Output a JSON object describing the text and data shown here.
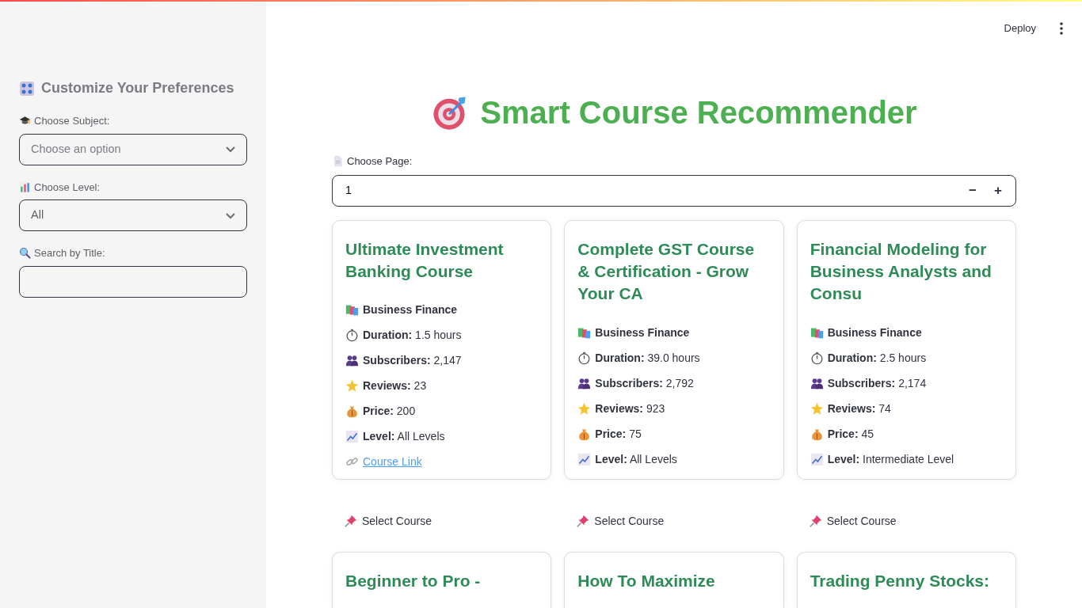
{
  "header": {
    "deploy": "Deploy"
  },
  "sidebar": {
    "title": "Customize Your Preferences",
    "fields": [
      {
        "kind": "select",
        "label": "Choose Subject:",
        "placeholder": "Choose an option"
      },
      {
        "kind": "select",
        "label": "Choose Level:",
        "value": "All"
      },
      {
        "kind": "text",
        "label": "Search by Title:"
      }
    ]
  },
  "main": {
    "title": "Smart Course Recommender",
    "page_input": {
      "label": "Choose Page:",
      "value": "1",
      "minus": "−",
      "plus": "+"
    },
    "courses": [
      {
        "title": "Ultimate Investment Banking Course",
        "stats": [
          {
            "kind": "category",
            "label": "Business Finance"
          },
          {
            "kind": "duration",
            "label": "Duration:",
            "value": "1.5 hours"
          },
          {
            "kind": "subscribers",
            "label": "Subscribers:",
            "value": "2,147"
          },
          {
            "kind": "reviews",
            "label": "Reviews:",
            "value": "23"
          },
          {
            "kind": "price",
            "label": "Price:",
            "value": "200"
          },
          {
            "kind": "level",
            "label": "Level:",
            "value": "All Levels"
          }
        ],
        "link": "Course Link",
        "select": "Select Course"
      },
      {
        "title": "Complete GST Course & Certification - Grow Your CA",
        "stats": [
          {
            "kind": "category",
            "label": "Business Finance"
          },
          {
            "kind": "duration",
            "label": "Duration:",
            "value": "39.0 hours"
          },
          {
            "kind": "subscribers",
            "label": "Subscribers:",
            "value": "2,792"
          },
          {
            "kind": "reviews",
            "label": "Reviews:",
            "value": "923"
          },
          {
            "kind": "price",
            "label": "Price:",
            "value": "75"
          },
          {
            "kind": "level",
            "label": "Level:",
            "value": "All Levels"
          }
        ],
        "select": "Select Course"
      },
      {
        "title": "Financial Modeling for Business Analysts and Consu",
        "stats": [
          {
            "kind": "category",
            "label": "Business Finance"
          },
          {
            "kind": "duration",
            "label": "Duration:",
            "value": "2.5 hours"
          },
          {
            "kind": "subscribers",
            "label": "Subscribers:",
            "value": "2,174"
          },
          {
            "kind": "reviews",
            "label": "Reviews:",
            "value": "74"
          },
          {
            "kind": "price",
            "label": "Price:",
            "value": "45"
          },
          {
            "kind": "level",
            "label": "Level:",
            "value": "Intermediate Level"
          }
        ],
        "select": "Select Course"
      },
      {
        "title": "Beginner to Pro -"
      },
      {
        "title": "How To Maximize"
      },
      {
        "title": "Trading Penny Stocks:"
      }
    ]
  }
}
